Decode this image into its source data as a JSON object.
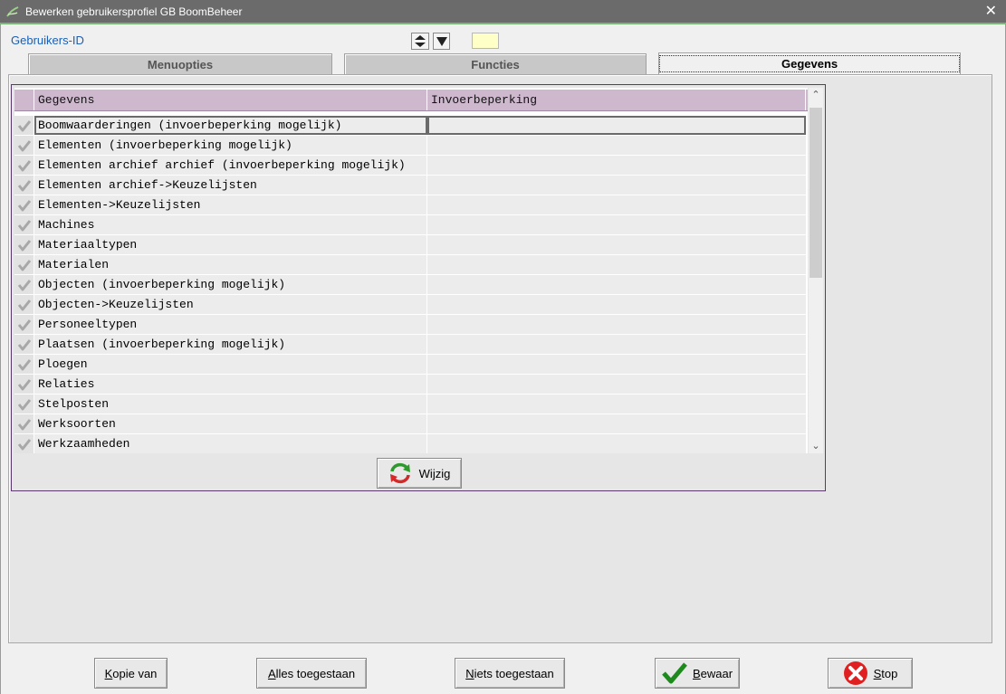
{
  "window": {
    "title": "Bewerken gebruikersprofiel GB BoomBeheer"
  },
  "header": {
    "user_id_label": "Gebruikers-ID",
    "user_id_value": ""
  },
  "tabs": [
    {
      "label": "Menuopties"
    },
    {
      "label": "Functies"
    },
    {
      "label": "Gegevens"
    }
  ],
  "grid": {
    "columns": [
      "Gegevens",
      "Invoerbeperking"
    ],
    "rows": [
      {
        "name": "Boomwaarderingen (invoerbeperking mogelijk)",
        "restriction": ""
      },
      {
        "name": "Elementen (invoerbeperking mogelijk)",
        "restriction": ""
      },
      {
        "name": "Elementen archief archief (invoerbeperking mogelijk)",
        "restriction": ""
      },
      {
        "name": "Elementen archief->Keuzelijsten",
        "restriction": ""
      },
      {
        "name": "Elementen->Keuzelijsten",
        "restriction": ""
      },
      {
        "name": "Machines",
        "restriction": ""
      },
      {
        "name": "Materiaaltypen",
        "restriction": ""
      },
      {
        "name": "Materialen",
        "restriction": ""
      },
      {
        "name": "Objecten (invoerbeperking mogelijk)",
        "restriction": ""
      },
      {
        "name": "Objecten->Keuzelijsten",
        "restriction": ""
      },
      {
        "name": "Personeeltypen",
        "restriction": ""
      },
      {
        "name": "Plaatsen (invoerbeperking mogelijk)",
        "restriction": ""
      },
      {
        "name": "Ploegen",
        "restriction": ""
      },
      {
        "name": "Relaties",
        "restriction": ""
      },
      {
        "name": "Stelposten",
        "restriction": ""
      },
      {
        "name": "Werksoorten",
        "restriction": ""
      },
      {
        "name": "Werkzaamheden",
        "restriction": ""
      }
    ]
  },
  "buttons": {
    "wijzig": "Wijzig",
    "kopie_first": "K",
    "kopie_rest": "opie van",
    "alles_first": "A",
    "alles_rest": "lles toegestaan",
    "niets_first": "N",
    "niets_rest": "iets toegestaan",
    "bewaar_first": "B",
    "bewaar_rest": "ewaar",
    "stop_first": "S",
    "stop_rest": "top"
  },
  "colors": {
    "header_purple": "#cdb8cd",
    "uid_field": "#ffffc8",
    "label_blue": "#1a5fb4"
  }
}
